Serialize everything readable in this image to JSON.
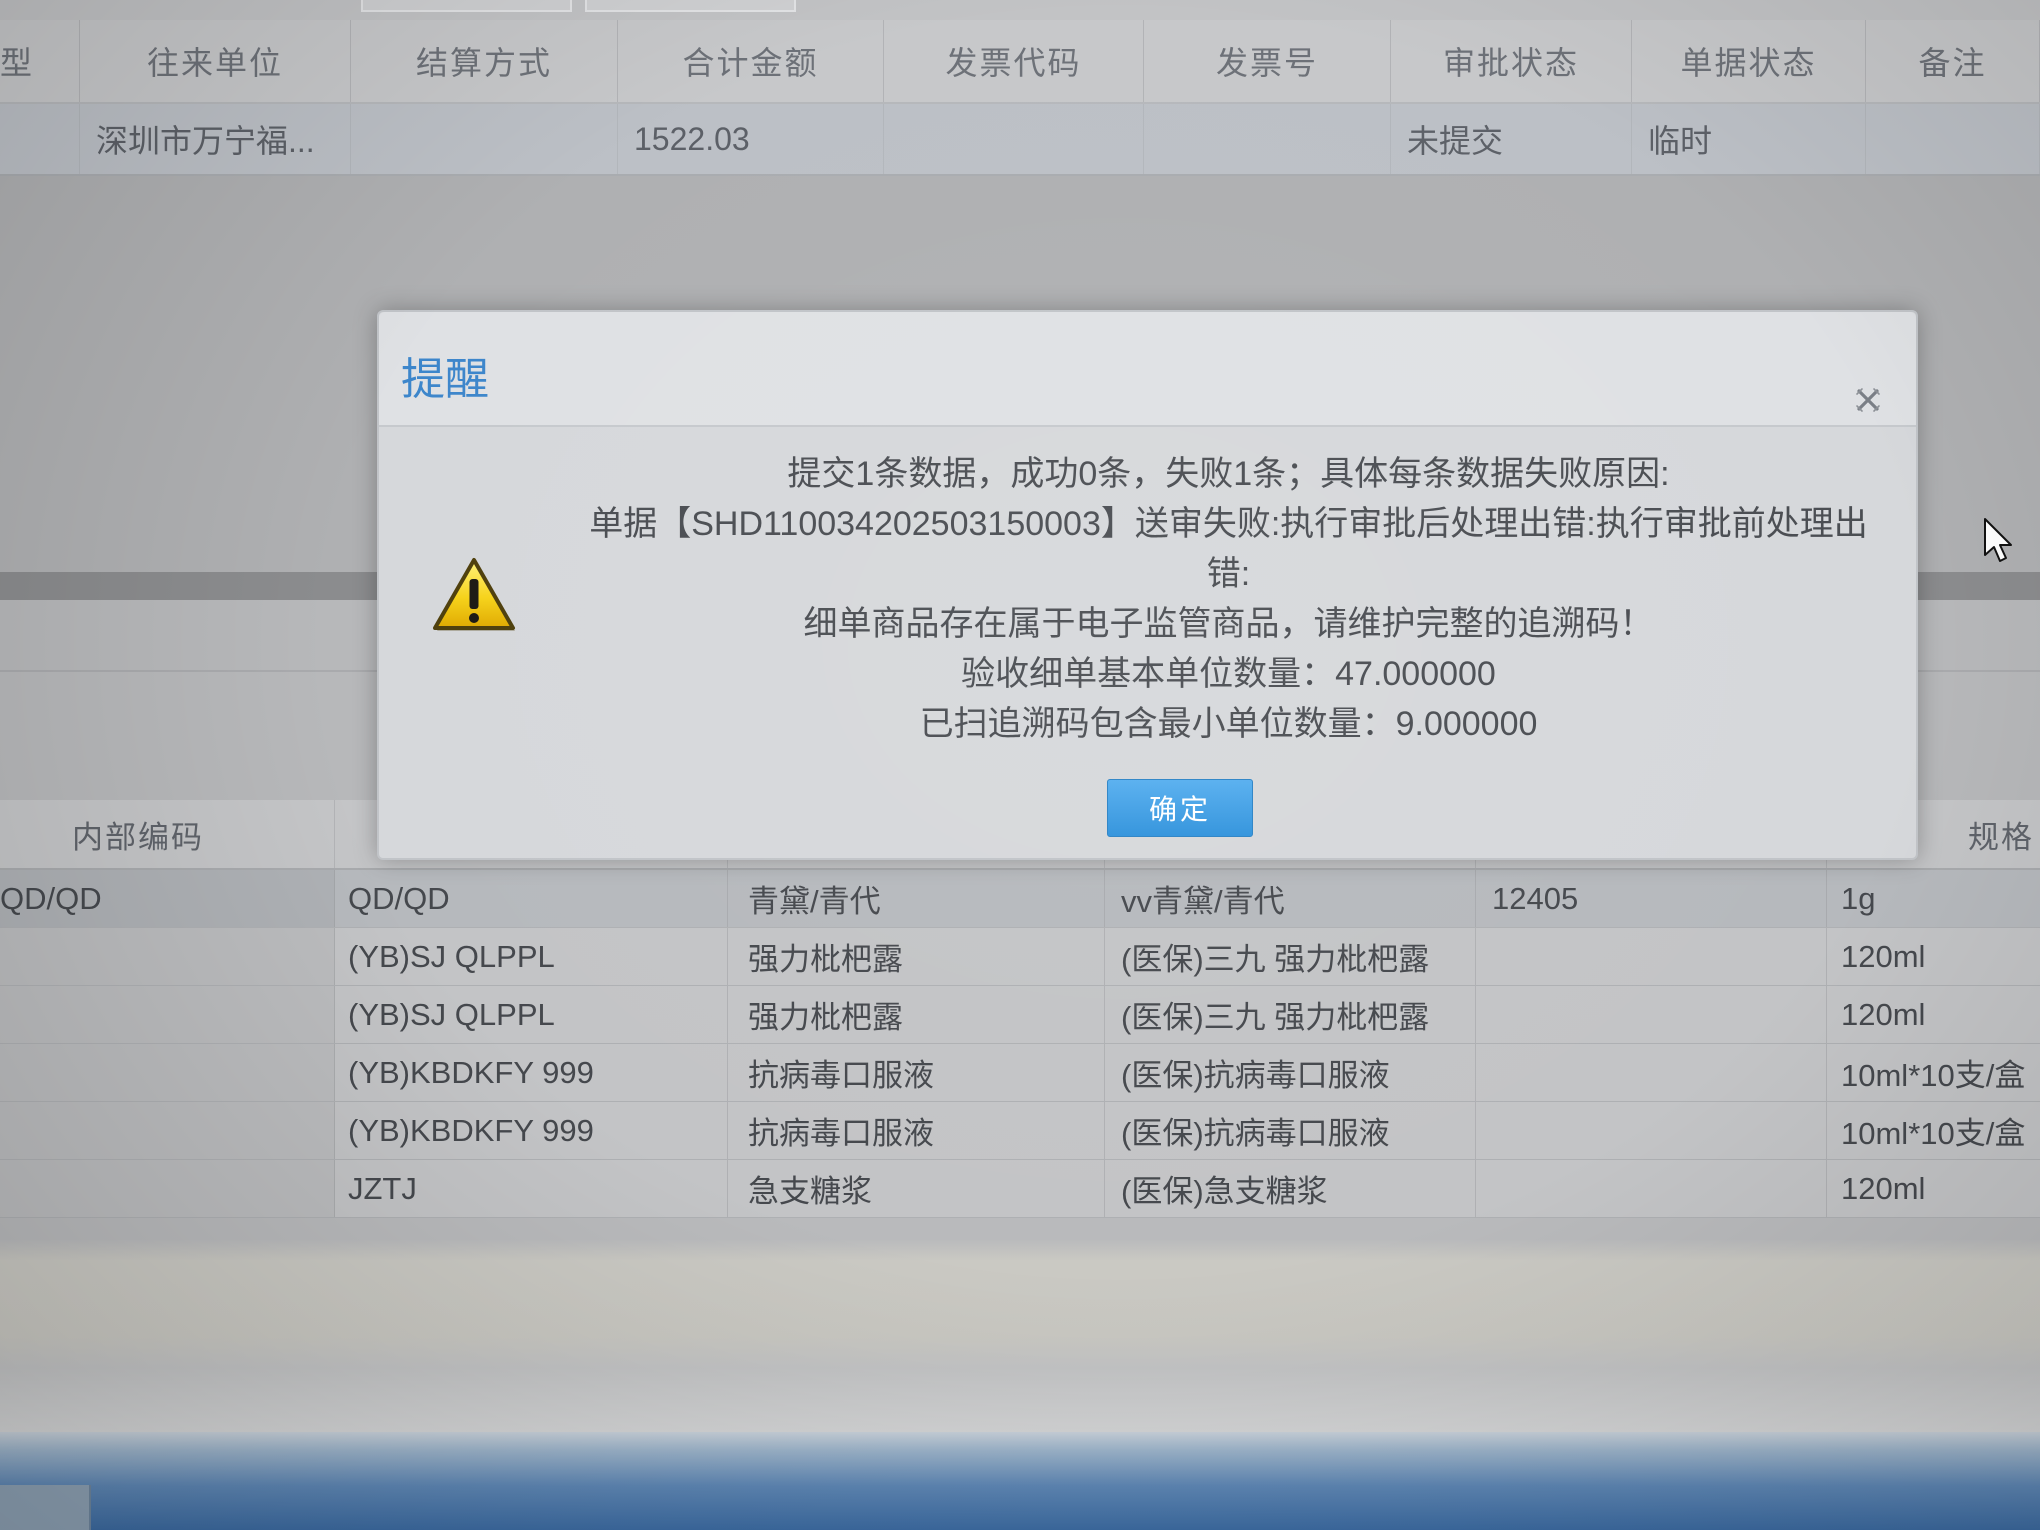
{
  "top_grid": {
    "columns": [
      "型",
      "往来单位",
      "结算方式",
      "合计金额",
      "发票代码",
      "发票号",
      "审批状态",
      "单据状态",
      "备注"
    ],
    "rows": [
      {
        "partner": "深圳市万宁福...",
        "total_amount": "1522.03",
        "approval_status": "未提交",
        "document_status": "临时"
      }
    ]
  },
  "detail_grid": {
    "columns": {
      "internal_code": "内部编码",
      "spec": "规格"
    },
    "rows": [
      {
        "internal_code": "QD/QD",
        "code": "QD/QD",
        "name": "青黛/青代",
        "full_name": "vv青黛/青代",
        "number": "12405",
        "spec": "1g"
      },
      {
        "code": "(YB)SJ QLPPL",
        "name": "强力枇杷露",
        "full_name": "(医保)三九 强力枇杷露",
        "spec": "120ml"
      },
      {
        "code": "(YB)SJ QLPPL",
        "name": "强力枇杷露",
        "full_name": "(医保)三九 强力枇杷露",
        "spec": "120ml"
      },
      {
        "code": "(YB)KBDKFY 999",
        "name": "抗病毒口服液",
        "full_name": "(医保)抗病毒口服液",
        "spec": "10ml*10支/盒"
      },
      {
        "code": "(YB)KBDKFY 999",
        "name": "抗病毒口服液",
        "full_name": "(医保)抗病毒口服液",
        "spec": "10ml*10支/盒"
      },
      {
        "code": "JZTJ",
        "name": "急支糖浆",
        "full_name": "(医保)急支糖浆",
        "spec": "120ml"
      }
    ]
  },
  "dialog": {
    "title": "提醒",
    "icon": "warning-icon",
    "close_icon": "close-icon",
    "message_lines": [
      "提交1条数据，成功0条，失败1条；具体每条数据失败原因:",
      "单据【SHD110034202503150003】送审失败:执行审批后处理出错:执行审批前处理出",
      "错:",
      "细单商品存在属于电子监管商品，请维护完整的追溯码！",
      "验收细单基本单位数量：47.000000",
      "已扫追溯码包含最小单位数量：9.000000"
    ],
    "ok_label": "确定"
  },
  "icons": {
    "pointer": "mouse-cursor-icon"
  },
  "colors": {
    "dialog_title": "#3d86cb",
    "ok_button": "#3a9be2",
    "warning_fill": "#f6d31a",
    "background": "#b0b1b3"
  }
}
